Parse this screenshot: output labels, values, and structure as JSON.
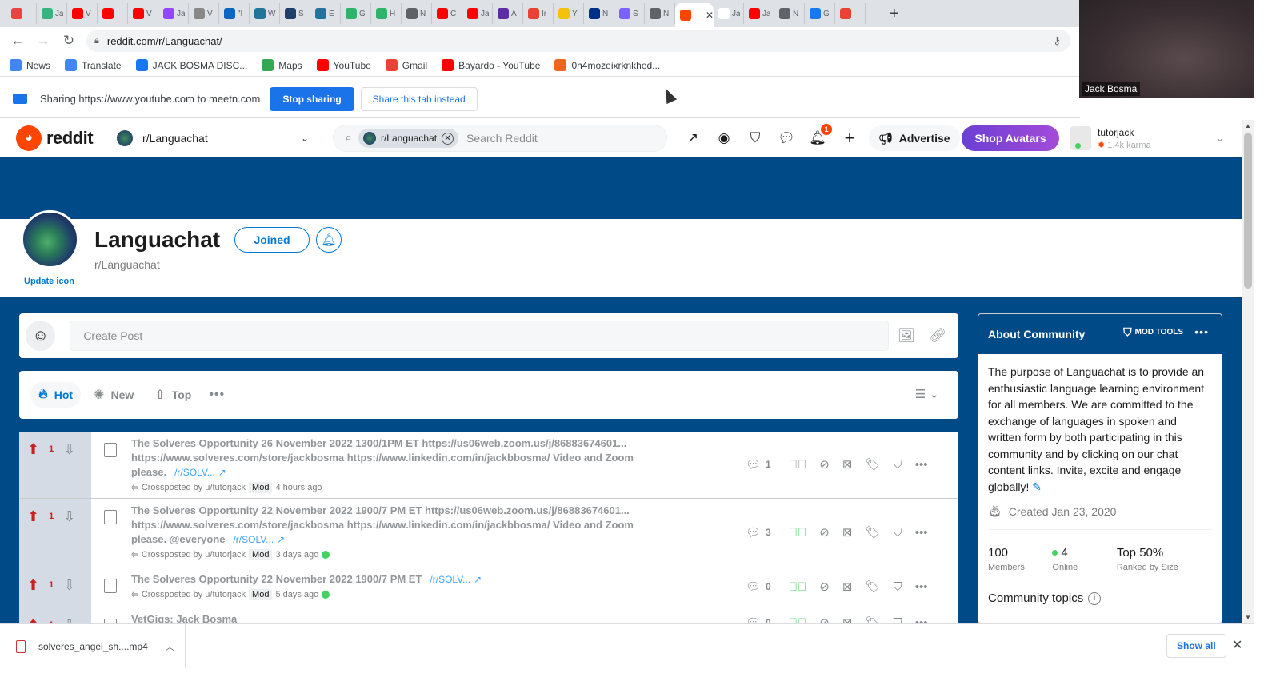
{
  "browser": {
    "tabs": [
      {
        "label": "",
        "color": "#e8453c"
      },
      {
        "label": "Ja",
        "color": "#36b37e"
      },
      {
        "label": "V",
        "color": "#ff0000"
      },
      {
        "label": "",
        "color": "#ff0000"
      },
      {
        "label": "V",
        "color": "#ff0000"
      },
      {
        "label": "Ja",
        "color": "#9146ff"
      },
      {
        "label": "V",
        "color": "#888888"
      },
      {
        "label": "\"I",
        "color": "#0a66c2"
      },
      {
        "label": "W",
        "color": "#21759b"
      },
      {
        "label": "S",
        "color": "#1f3f6b"
      },
      {
        "label": "E",
        "color": "#21759b"
      },
      {
        "label": "G",
        "color": "#2fb36a"
      },
      {
        "label": "H",
        "color": "#2fb36a"
      },
      {
        "label": "N",
        "color": "#5f6368"
      },
      {
        "label": "C",
        "color": "#ff0000"
      },
      {
        "label": "Ja",
        "color": "#ff0000"
      },
      {
        "label": "A",
        "color": "#5e2ca5"
      },
      {
        "label": "Ir",
        "color": "#ea4335"
      },
      {
        "label": "Y",
        "color": "#f4c20d"
      },
      {
        "label": "N",
        "color": "#003087"
      },
      {
        "label": "S",
        "color": "#7b61ff"
      },
      {
        "label": "N",
        "color": "#5f6368"
      },
      {
        "label": "",
        "color": "#ff4500",
        "active": true
      },
      {
        "label": "Ja",
        "color": "#ffffff"
      },
      {
        "label": "Ja",
        "color": "#ff0000"
      },
      {
        "label": "N",
        "color": "#5f6368"
      },
      {
        "label": "G",
        "color": "#1877f2"
      },
      {
        "label": "",
        "color": "#ea4335"
      }
    ],
    "new_tab": "+",
    "url": "reddit.com/r/Languachat/",
    "bookmarks": [
      {
        "label": "News",
        "icon": "news-icon",
        "color": "#4285f4"
      },
      {
        "label": "Translate",
        "icon": "translate-icon",
        "color": "#4285f4"
      },
      {
        "label": "JACK BOSMA DISC...",
        "icon": "facebook-icon",
        "color": "#1877f2"
      },
      {
        "label": "Maps",
        "icon": "maps-pin-icon",
        "color": "#34a853"
      },
      {
        "label": "YouTube",
        "icon": "youtube-icon",
        "color": "#ff0000"
      },
      {
        "label": "Gmail",
        "icon": "gmail-icon",
        "color": "#ea4335"
      },
      {
        "label": "Bayardo - YouTube",
        "icon": "youtube-icon",
        "color": "#ff0000"
      },
      {
        "label": "0h4mozeixrknkhed...",
        "icon": "etsy-icon",
        "color": "#f1641e"
      }
    ],
    "sharing": {
      "text": "Sharing https://www.youtube.com to meetn.com",
      "stop_label": "Stop sharing",
      "share_tab_label": "Share this tab instead"
    },
    "webcam_name": "Jack Bosma",
    "download": {
      "filename": "solveres_angel_sh....mp4",
      "show_all": "Show all"
    }
  },
  "reddit": {
    "wordmark": "reddit",
    "community_selector": "r/Languachat",
    "search": {
      "scope": "r/Languachat",
      "placeholder": "Search Reddit"
    },
    "notifications_count": "1",
    "advertise_label": "Advertise",
    "shop_avatars_label": "Shop Avatars",
    "user": {
      "name": "tutorjack",
      "karma": "1.4k karma"
    }
  },
  "subreddit": {
    "title": "Languachat",
    "name": "r/Languachat",
    "update_icon": "Update icon",
    "joined_label": "Joined"
  },
  "create_post": {
    "placeholder": "Create Post"
  },
  "sort": {
    "hot": "Hot",
    "new": "New",
    "top": "Top"
  },
  "posts": [
    {
      "score": "1",
      "title": "The Solveres Opportunity 26 November 2022 1300/1PM ET https://us06web.zoom.us/j/86883674601... https://www.solveres.com/store/jackbosma https://www.linkedin.com/in/jackbbosma/ Video and Zoom please.",
      "link": "/r/SOLV...",
      "crosspost": "Crossposted by u/tutorjack",
      "mod": "Mod",
      "time": "4 hours ago",
      "approved": false,
      "comments": "1"
    },
    {
      "score": "1",
      "title": "The Solveres Opportunity 22 November 2022 1900/7 PM ET https://us06web.zoom.us/j/86883674601... https://www.solveres.com/store/jackbosma https://www.linkedin.com/in/jackbbosma/ Video and Zoom please. @everyone",
      "link": "/r/SOLV...",
      "crosspost": "Crossposted by u/tutorjack",
      "mod": "Mod",
      "time": "3 days ago",
      "approved": true,
      "comments": "3"
    },
    {
      "score": "1",
      "title": "The Solveres Opportunity 22 November 2022 1900/7 PM ET",
      "link": "/r/SOLV...",
      "crosspost": "Crossposted by u/tutorjack",
      "mod": "Mod",
      "time": "5 days ago",
      "approved": true,
      "comments": "0"
    },
    {
      "score": "1",
      "title": "VetGigs: Jack Bosma",
      "link": "",
      "crosspost": "",
      "mod": "",
      "time": "",
      "approved": true,
      "comments": "0"
    }
  ],
  "about": {
    "title": "About Community",
    "mod_tools": "MOD TOOLS",
    "description": "The purpose of Languachat is to provide an enthusiastic language learning environment for all members. We are committed to the exchange of languages in spoken and written form by both participating in this community and by clicking on our chat content links. Invite, excite and engage globally!",
    "created": "Created Jan 23, 2020",
    "members_value": "100",
    "members_label": "Members",
    "online_value": "4",
    "online_label": "Online",
    "rank_value": "Top 50%",
    "rank_label": "Ranked by Size",
    "topics_label": "Community topics"
  }
}
